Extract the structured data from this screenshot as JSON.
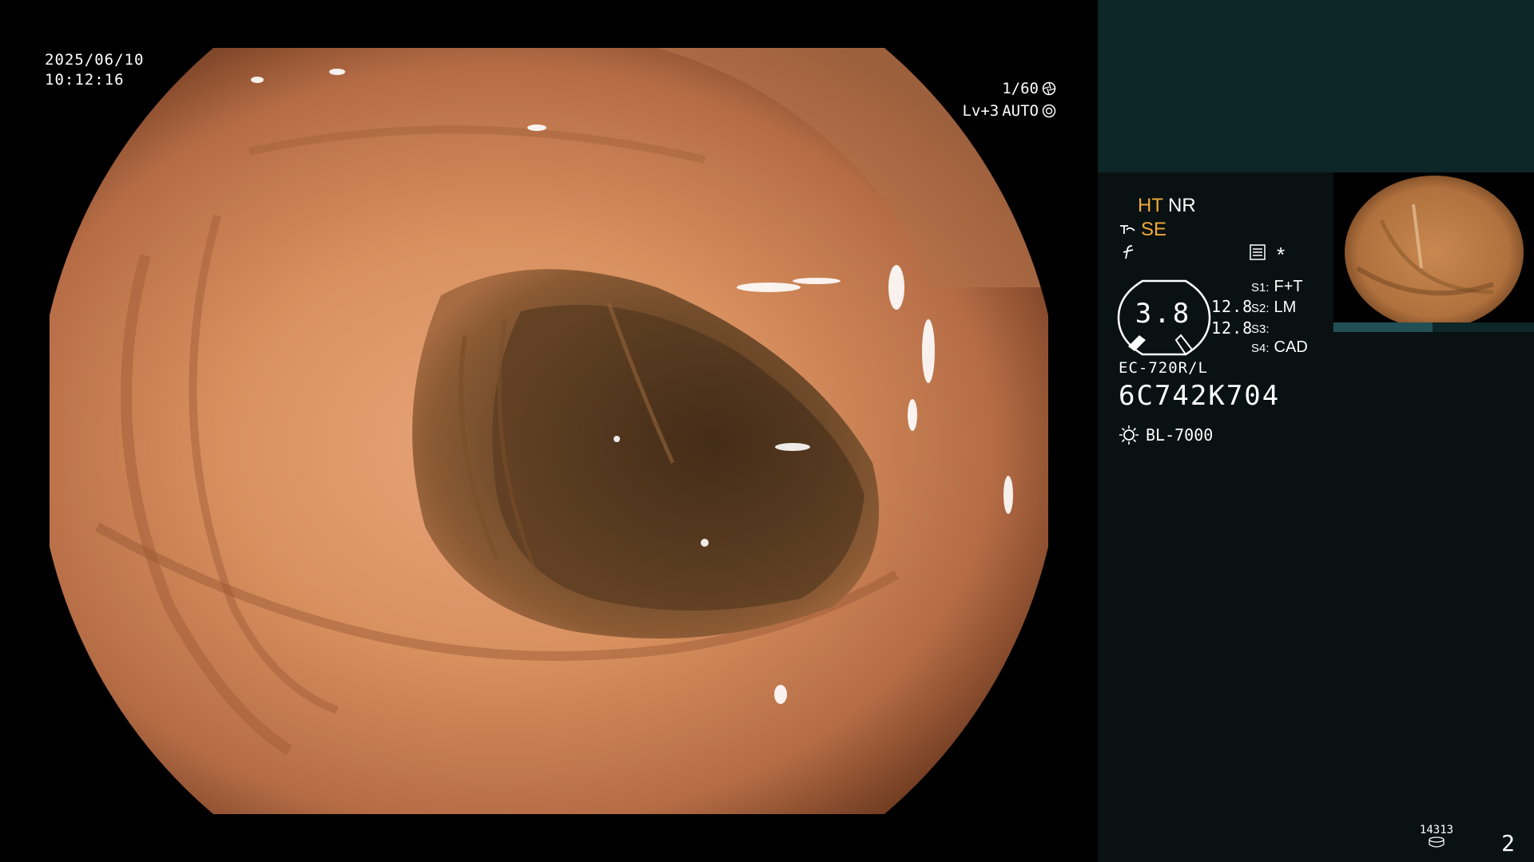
{
  "overlay": {
    "date": "2025/06/10",
    "time": "10:12:16",
    "shutter": "1/60",
    "level": "Lv+3",
    "iris_mode": "AUTO"
  },
  "panel": {
    "ht_label": "HT",
    "nr_label": "NR",
    "se_label": "SE",
    "zoom_value": "3.8",
    "ratio_1": "12.8",
    "ratio_2": "12.8",
    "switches": [
      {
        "key": "S1",
        "sep": ":",
        "value": "F+T"
      },
      {
        "key": "S2",
        "sep": ":",
        "value": "LM"
      },
      {
        "key": "S3",
        "sep": ":",
        "value": ""
      },
      {
        "key": "S4",
        "sep": ":",
        "value": "CAD"
      }
    ],
    "asterisk": "*",
    "scope_model": "EC-720R/L",
    "scope_serial": "6C742K704",
    "light_source": "BL-7000",
    "counter": "14313",
    "page_number": "2"
  },
  "colors": {
    "background": "#000000",
    "panel_bg": "#091112",
    "teal_band": "#0d2628",
    "highlight": "#f0a93a",
    "tissue": "#d38a62"
  },
  "icons": [
    "aperture-icon",
    "iris-icon",
    "structure-enhance-icon",
    "f-mode-icon",
    "settings-list-icon",
    "light-bulb-icon",
    "disk-icon"
  ]
}
